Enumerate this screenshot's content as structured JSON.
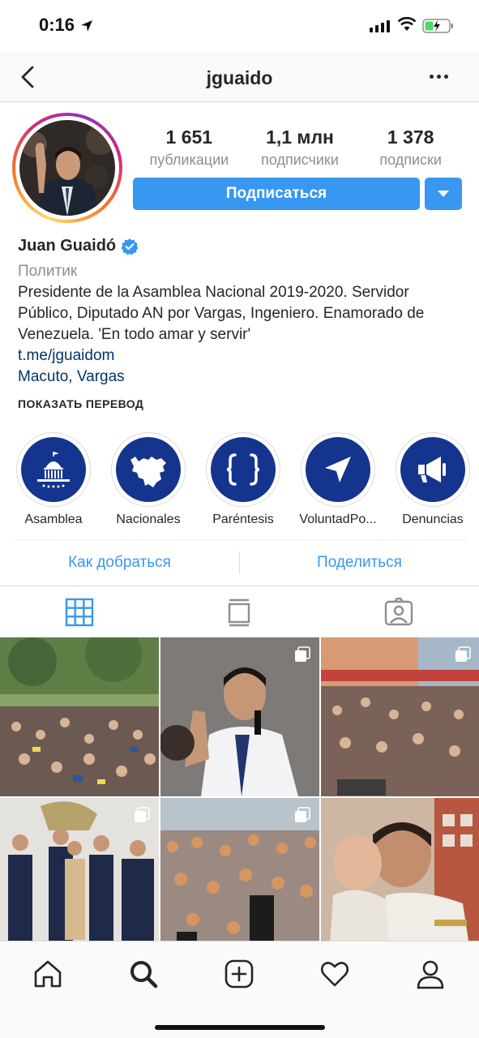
{
  "status_bar": {
    "time": "0:16"
  },
  "nav": {
    "title": "jguaido"
  },
  "profile": {
    "stats": [
      {
        "value": "1 651",
        "label": "публикации"
      },
      {
        "value": "1,1 млн",
        "label": "подписчики"
      },
      {
        "value": "1 378",
        "label": "подписки"
      }
    ],
    "follow_label": "Подписаться",
    "name": "Juan Guaidó",
    "category": "Политик",
    "bio": "Presidente de la Asamblea Nacional 2019-2020. Servidor Público, Diputado AN por Vargas, Ingeniero. Enamorado de Venezuela. 'En todo amar y servir'",
    "link": "t.me/jguaidom",
    "location": "Macuto, Vargas",
    "translate_label": "ПОКАЗАТЬ ПЕРЕВОД"
  },
  "highlights": [
    {
      "label": "Asamblea",
      "icon": "capitol-icon"
    },
    {
      "label": "Nacionales",
      "icon": "venezuela-map-icon"
    },
    {
      "label": "Paréntesis",
      "icon": "braces-icon"
    },
    {
      "label": "VoluntadPo...",
      "icon": "send-arrow-icon"
    },
    {
      "label": "Denuncias",
      "icon": "megaphone-icon"
    }
  ],
  "actions": {
    "directions": "Как добраться",
    "share": "Поделиться"
  },
  "colors": {
    "accent": "#3897f0",
    "highlight_bg": "#14348d",
    "link": "#003569"
  }
}
